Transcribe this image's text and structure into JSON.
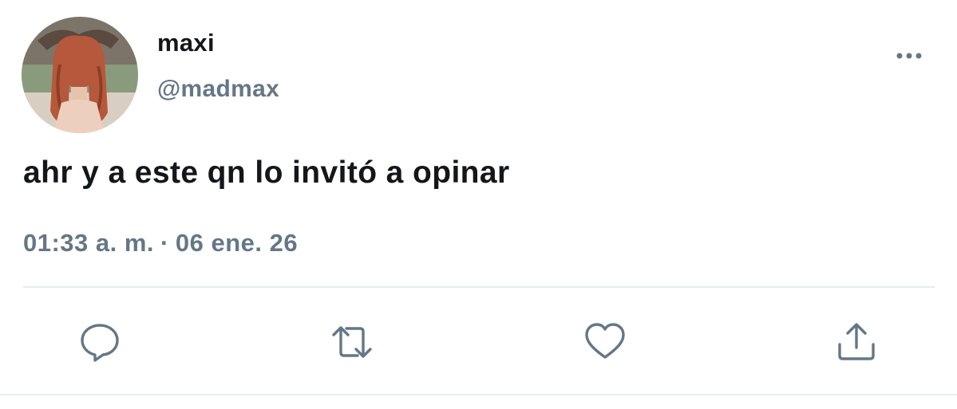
{
  "tweet": {
    "author": {
      "display_name": "maxi",
      "handle": "@madmax"
    },
    "text": "ahr y a este qn lo invitó a opinar",
    "time": "01:33 a. m.",
    "separator": "·",
    "date": "06 ene. 26"
  },
  "icons": {
    "more": "more-horizontal-icon",
    "reply": "reply-bubble-icon",
    "retweet": "retweet-icon",
    "like": "heart-icon",
    "share": "share-upload-icon"
  },
  "colors": {
    "text_primary": "#14171a",
    "text_secondary": "#657786",
    "icon": "#657786",
    "divider": "#e6ecf0"
  }
}
